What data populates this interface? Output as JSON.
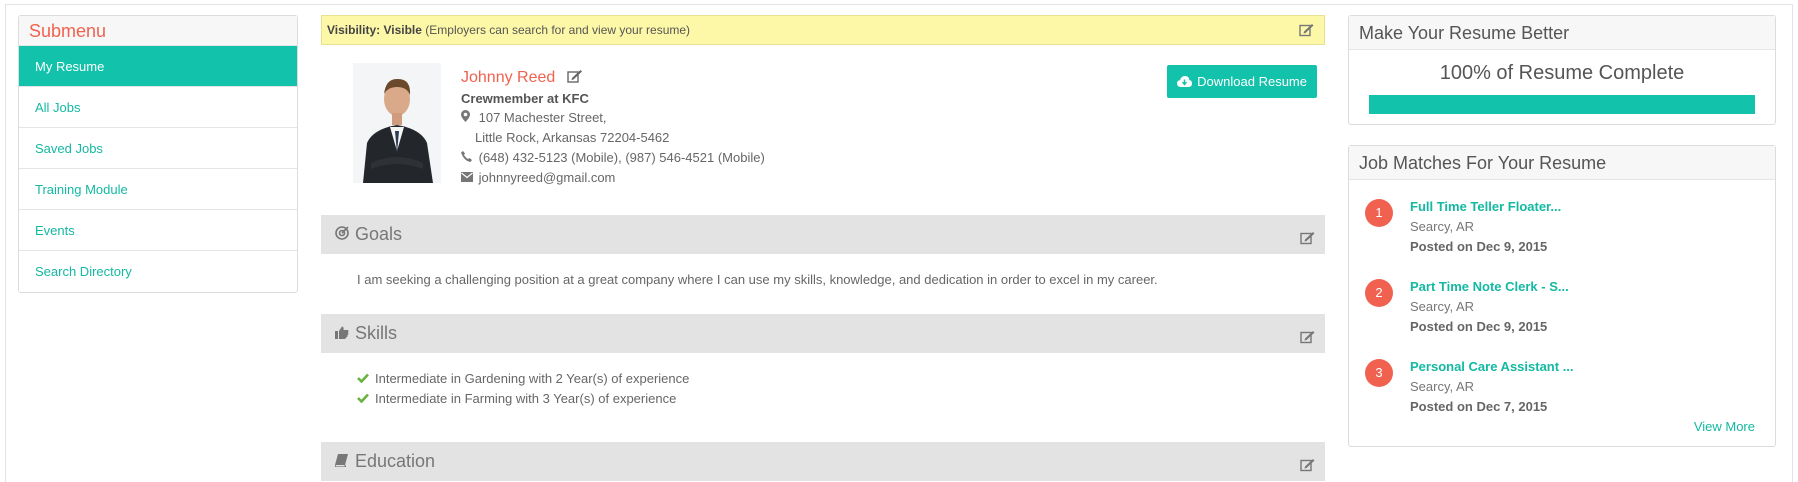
{
  "sidebar": {
    "title": "Submenu",
    "items": [
      {
        "label": "My Resume"
      },
      {
        "label": "All Jobs"
      },
      {
        "label": "Saved Jobs"
      },
      {
        "label": "Training Module"
      },
      {
        "label": "Events"
      },
      {
        "label": "Search Directory"
      }
    ]
  },
  "visibility": {
    "label": "Visibility: Visible",
    "note": "(Employers can search for and view your resume)"
  },
  "profile": {
    "name": "Johnny Reed",
    "headline": "Crewmember at KFC",
    "address_line1": "107 Machester Street,",
    "address_line2": "Little Rock, Arkansas  72204-5462",
    "phones": "(648) 432-5123 (Mobile), (987) 546-4521 (Mobile)",
    "email": "johnnyreed@gmail.com",
    "download_label": "Download Resume"
  },
  "sections": {
    "goals": {
      "title": "Goals",
      "text": "I am seeking a challenging position at a great company where I can use my skills, knowledge, and dedication in order to excel in my career."
    },
    "skills": {
      "title": "Skills",
      "items": [
        "Intermediate in Gardening with 2  Year(s) of experience",
        "Intermediate in Farming with 3  Year(s) of experience"
      ]
    },
    "education": {
      "title": "Education"
    }
  },
  "resume_better": {
    "title": "Make Your Resume Better",
    "complete_text": "100% of Resume Complete",
    "progress_fraction": 1.0
  },
  "job_matches": {
    "title": "Job Matches For Your Resume",
    "jobs": [
      {
        "num": "1",
        "title": "Full Time Teller Floater...",
        "location": "Searcy, AR",
        "posted": "Posted on Dec 9, 2015"
      },
      {
        "num": "2",
        "title": "Part Time Note Clerk - S...",
        "location": "Searcy, AR",
        "posted": "Posted on Dec 9, 2015"
      },
      {
        "num": "3",
        "title": "Personal Care Assistant ...",
        "location": "Searcy, AR",
        "posted": "Posted on Dec 7, 2015"
      }
    ],
    "view_more": "View More"
  },
  "colors": {
    "accent": "#13c2ab",
    "brand_red": "#f0624f",
    "visibility_bg": "#fdf8a8"
  }
}
